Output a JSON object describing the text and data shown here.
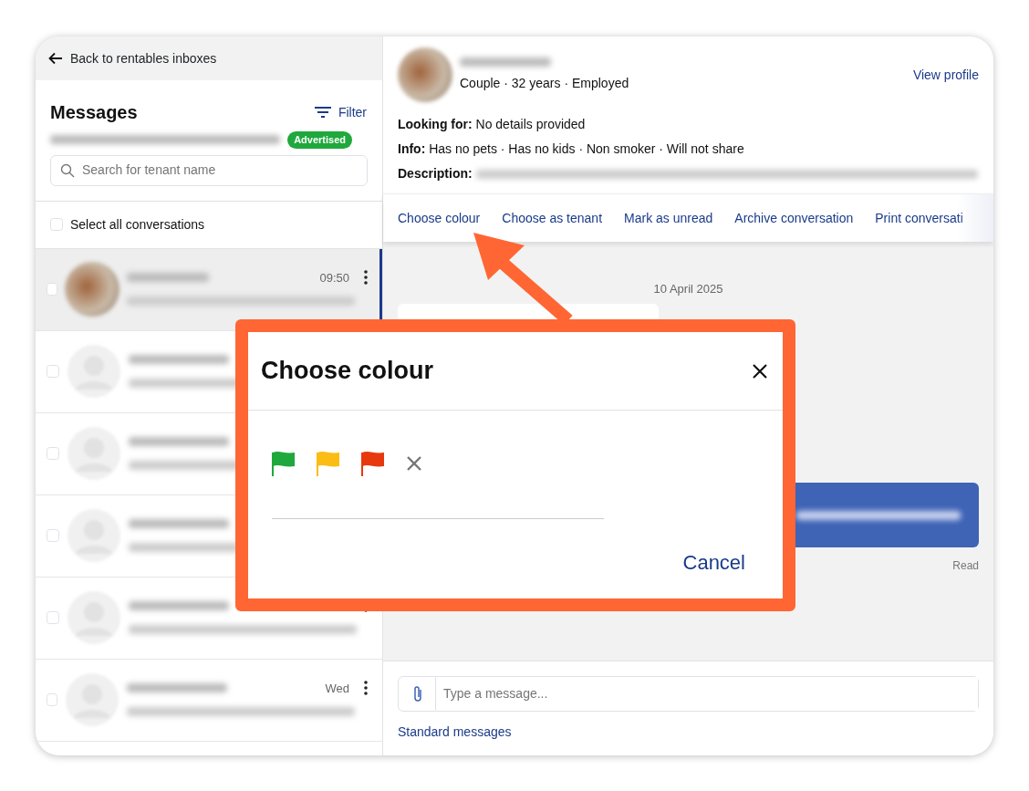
{
  "back_link": "Back to rentables inboxes",
  "sidebar": {
    "title": "Messages",
    "filter": "Filter",
    "status_badge": "Advertised",
    "search": {
      "placeholder": "Search for tenant name"
    },
    "select_all": {
      "label": "Select all conversations",
      "checked": false
    },
    "conversations": [
      {
        "time": "09:50",
        "selected": true,
        "checked": false,
        "has_photo": true
      },
      {
        "selected": false,
        "checked": false,
        "has_photo": false
      },
      {
        "selected": false,
        "checked": false,
        "has_photo": false
      },
      {
        "selected": false,
        "checked": false,
        "has_photo": false
      },
      {
        "selected": false,
        "checked": false,
        "has_photo": false
      },
      {
        "time": "Wed",
        "selected": false,
        "checked": false,
        "has_photo": false
      }
    ]
  },
  "profile": {
    "details": "Couple · 32 years · Employed",
    "view_profile": "View profile",
    "fields": [
      {
        "text": "**Looking for:** No details provided"
      },
      {
        "text": "**Info:** Has no pets · Has no kids · Non smoker · Will not share"
      },
      {
        "text": "**Description:**",
        "blurred": true
      }
    ]
  },
  "actions": [
    "Choose colour",
    "Choose as tenant",
    "Mark as unread",
    "Archive conversation",
    "Print conversati"
  ],
  "chat": {
    "date": "10 April 2025",
    "read_receipt": "Read"
  },
  "composer": {
    "placeholder": "Type a message...",
    "standard_messages": "Standard messages"
  },
  "modal": {
    "title": "Choose colour",
    "flags": [
      {
        "color": "#1fa83c"
      },
      {
        "color": "#fbbc14"
      },
      {
        "color": "#e8380d"
      }
    ],
    "cancel": "Cancel"
  }
}
